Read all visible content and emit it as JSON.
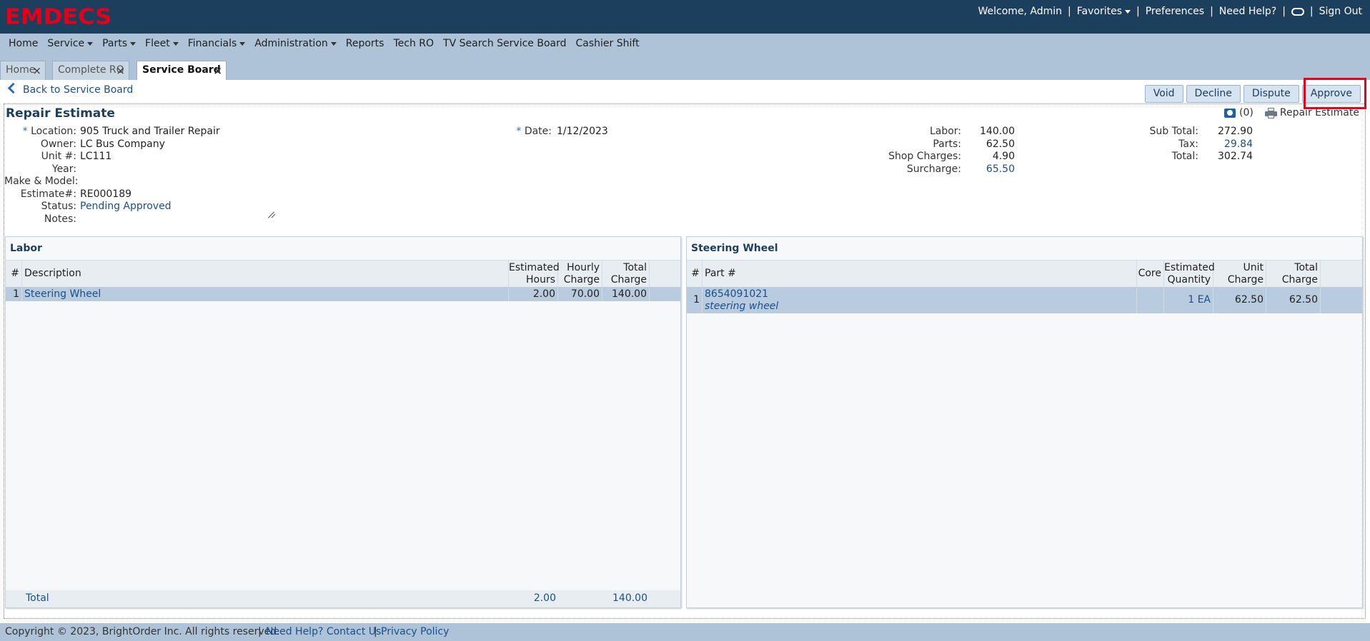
{
  "app": {
    "logo": "EMDECS"
  },
  "usernav": {
    "welcome": "Welcome, Admin",
    "favorites": "Favorites",
    "preferences": "Preferences",
    "help": "Need Help?",
    "signout": "Sign Out"
  },
  "menu": [
    "Home",
    "Service",
    "Parts",
    "Fleet",
    "Financials",
    "Administration",
    "Reports",
    "Tech RO",
    "TV Search Service Board",
    "Cashier Shift"
  ],
  "tabs": [
    "Home",
    "Complete RO",
    "Service Board"
  ],
  "back_label": "Back to Service Board",
  "actions": {
    "void": "Void",
    "decline": "Decline",
    "dispute": "Dispute",
    "approve": "Approve"
  },
  "estimate": {
    "title": "Repair Estimate",
    "photos_count": "(0)",
    "print_label": "Repair Estimate",
    "fields": {
      "location_label": "Location:",
      "location": "905 Truck and Trailer Repair",
      "owner_label": "Owner:",
      "owner": "LC Bus Company",
      "unit_label": "Unit #:",
      "unit": "LC111",
      "year_label": "Year:",
      "year": "",
      "make_label": "Make & Model:",
      "make": "",
      "estimate_label": "Estimate#:",
      "estimate_no": "RE000189",
      "status_label": "Status:",
      "status": "Pending Approved",
      "notes_label": "Notes:",
      "notes": "",
      "date_label": "Date:",
      "date": "1/12/2023"
    },
    "charges": {
      "labor_label": "Labor:",
      "labor": "140.00",
      "parts_label": "Parts:",
      "parts": "62.50",
      "shop_label": "Shop Charges:",
      "shop": "4.90",
      "surcharge_label": "Surcharge:",
      "surcharge": "65.50"
    },
    "totals": {
      "subtotal_label": "Sub Total:",
      "subtotal": "272.90",
      "tax_label": "Tax:",
      "tax": "29.84",
      "total_label": "Total:",
      "total": "302.74"
    }
  },
  "labor": {
    "title": "Labor",
    "headers": {
      "num": "#",
      "desc": "Description",
      "hours_1": "Estimated",
      "hours_2": "Hours",
      "rate_1": "Hourly",
      "rate_2": "Charge",
      "total_1": "Total",
      "total_2": "Charge"
    },
    "rows": [
      {
        "num": "1",
        "desc": "Steering Wheel",
        "hours": "2.00",
        "rate": "70.00",
        "total": "140.00"
      }
    ],
    "footer": {
      "label": "Total",
      "hours": "2.00",
      "total": "140.00"
    }
  },
  "parts": {
    "title": "Steering Wheel",
    "headers": {
      "num": "#",
      "part": "Part #",
      "core": "Core",
      "qty_1": "Estimated",
      "qty_2": "Quantity",
      "unit_1": "Unit",
      "unit_2": "Charge",
      "total_1": "Total",
      "total_2": "Charge"
    },
    "rows": [
      {
        "num": "1",
        "part_no": "8654091021",
        "part_desc": "steering wheel",
        "core": "",
        "qty": "1 EA",
        "unit": "62.50",
        "total": "62.50"
      }
    ]
  },
  "footer": {
    "copyright": "Copyright © 2023, BrightOrder Inc. All rights reserved.",
    "help": "Need Help? Contact Us.",
    "privacy": "Privacy Policy"
  }
}
